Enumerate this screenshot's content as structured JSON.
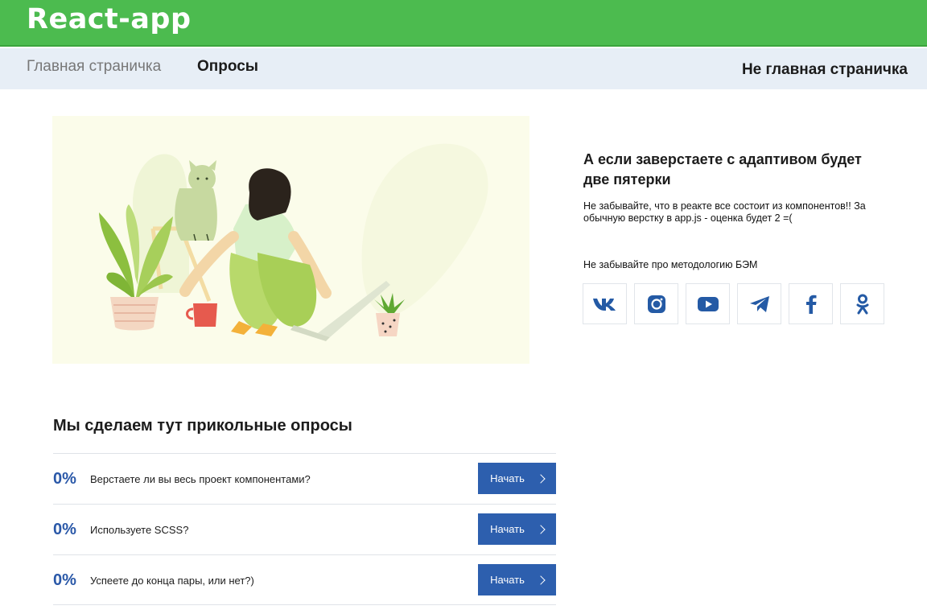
{
  "header": {
    "brand": "React-app"
  },
  "nav": {
    "home": "Главная страничка",
    "polls": "Опросы",
    "other": "Не главная страничка"
  },
  "promo": {
    "title": "А если заверстаете с адаптивом будет две пятерки",
    "text": "Не забывайте, что в реакте все состоит из компонентов!! За обычную верстку в app.js - оценка будет 2 =(",
    "note": "Не забывайте про методологию БЭМ"
  },
  "socials": [
    {
      "name": "vk-icon"
    },
    {
      "name": "instagram-icon"
    },
    {
      "name": "youtube-icon"
    },
    {
      "name": "telegram-icon"
    },
    {
      "name": "facebook-icon"
    },
    {
      "name": "odnoklassniki-icon"
    }
  ],
  "polls": {
    "title": "Мы сделаем тут прикольные опросы",
    "items": [
      {
        "percent": "0%",
        "question": "Верстаете ли вы весь проект компонентами?",
        "button": "Начать"
      },
      {
        "percent": "0%",
        "question": "Используете SCSS?",
        "button": "Начать"
      },
      {
        "percent": "0%",
        "question": "Успеете до конца пары, или нет?)",
        "button": "Начать"
      }
    ]
  },
  "colors": {
    "header": "#4cbb4f",
    "navbar": "#e7eef6",
    "accent": "#2d5fae",
    "social_icon": "#245aa5"
  }
}
